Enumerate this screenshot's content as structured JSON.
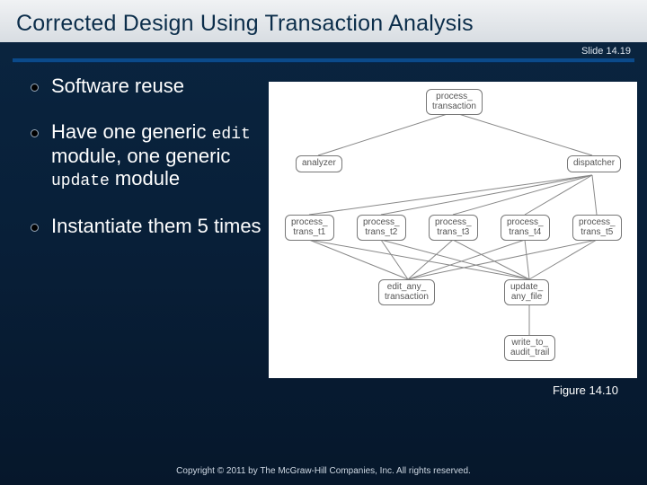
{
  "header": {
    "title": "Corrected Design Using Transaction Analysis",
    "slide_number": "Slide 14.19"
  },
  "bullets": {
    "b1": "Software reuse",
    "b2_pre": "Have one generic ",
    "b2_code1": "edit",
    "b2_mid": " module, one generic ",
    "b2_code2": "update",
    "b2_post": " module",
    "b3": "Instantiate them 5 times"
  },
  "diagram": {
    "root": "process_\ntransaction",
    "row2": {
      "analyzer": "analyzer",
      "dispatcher": "dispatcher"
    },
    "row3": {
      "t1": "process_\ntrans_t1",
      "t2": "process_\ntrans_t2",
      "t3": "process_\ntrans_t3",
      "t4": "process_\ntrans_t4",
      "t5": "process_\ntrans_t5"
    },
    "row4": {
      "edit": "edit_any_\ntransaction",
      "update": "update_\nany_file"
    },
    "row5": {
      "audit": "write_to_\naudit_trail"
    }
  },
  "figure_caption": "Figure 14.10",
  "copyright": "Copyright © 2011 by The McGraw-Hill Companies, Inc.  All rights reserved."
}
